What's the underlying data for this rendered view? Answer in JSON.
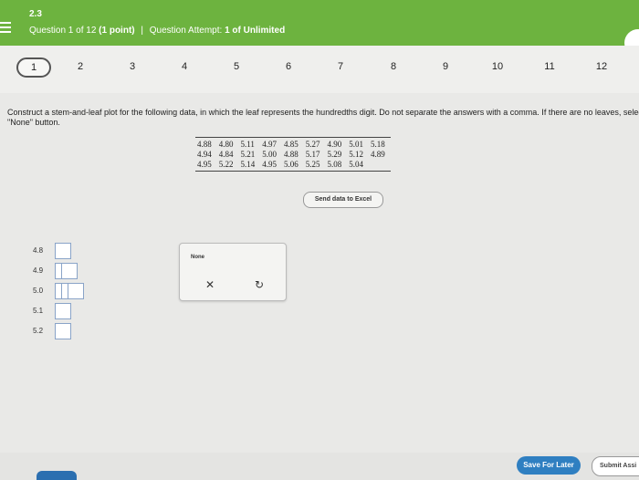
{
  "header": {
    "section": "2.3",
    "question_prefix": "Question 1 of 12",
    "points": "(1 point)",
    "attempt_label": "Question Attempt:",
    "attempt_value": "1 of Unlimited",
    "bg_color": "#6db33f"
  },
  "nav": {
    "questions": [
      "1",
      "2",
      "3",
      "4",
      "5",
      "6",
      "7",
      "8",
      "9",
      "10",
      "11",
      "12"
    ],
    "active_index": 0
  },
  "question": {
    "instructions": "Construct a stem-and-leaf plot for the following data, in which the leaf represents the hundredths digit. Do not separate the answers with a comma. If there are no leaves, select the \"None\" button."
  },
  "data_table": [
    [
      "4.88",
      "4.80",
      "5.11",
      "4.97",
      "4.85",
      "5.27",
      "4.90",
      "5.01",
      "5.18"
    ],
    [
      "4.94",
      "4.84",
      "5.21",
      "5.00",
      "4.88",
      "5.17",
      "5.29",
      "5.12",
      "4.89"
    ],
    [
      "4.95",
      "5.22",
      "5.14",
      "4.95",
      "5.06",
      "5.25",
      "5.08",
      "5.04",
      ""
    ]
  ],
  "send_button": "Send data to Excel",
  "stems": [
    {
      "label": "4.8",
      "boxes": 1
    },
    {
      "label": "4.9",
      "boxes": 2
    },
    {
      "label": "5.0",
      "boxes": 3
    },
    {
      "label": "5.1",
      "boxes": 1
    },
    {
      "label": "5.2",
      "boxes": 1
    }
  ],
  "toolbox": {
    "none_label": "None",
    "clear_icon": "close-icon",
    "reset_icon": "undo-icon"
  },
  "footer": {
    "save_label": "Save For Later",
    "submit_label": "Submit Assi",
    "save_color": "#2f7fc1"
  }
}
